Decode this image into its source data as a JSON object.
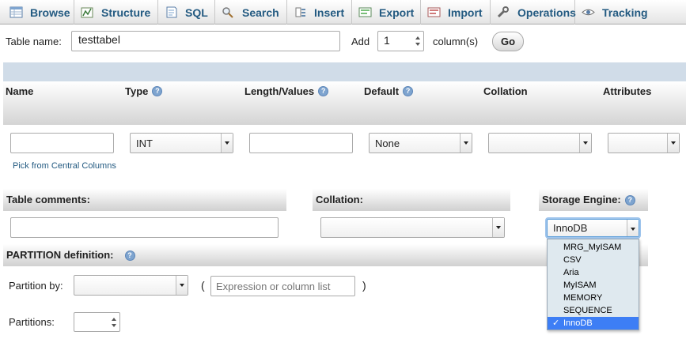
{
  "tabs": [
    {
      "label": "Browse",
      "icon": "browse-icon"
    },
    {
      "label": "Structure",
      "icon": "structure-icon"
    },
    {
      "label": "SQL",
      "icon": "sql-icon"
    },
    {
      "label": "Search",
      "icon": "search-icon"
    },
    {
      "label": "Insert",
      "icon": "insert-icon"
    },
    {
      "label": "Export",
      "icon": "export-icon"
    },
    {
      "label": "Import",
      "icon": "import-icon"
    },
    {
      "label": "Operations",
      "icon": "wrench-icon"
    },
    {
      "label": "Tracking",
      "icon": "eye-icon"
    }
  ],
  "table_form": {
    "table_name_label": "Table name:",
    "table_name_value": "testtabel",
    "add_label": "Add",
    "add_count": "1",
    "columns_label": "column(s)",
    "go_label": "Go"
  },
  "columns": {
    "headers": {
      "name": "Name",
      "type": "Type",
      "length": "Length/Values",
      "default": "Default",
      "collation": "Collation",
      "attributes": "Attributes"
    },
    "row": {
      "type_value": "INT",
      "default_value": "None",
      "pick_link": "Pick from Central Columns"
    }
  },
  "table_options": {
    "comments_label": "Table comments:",
    "collation_label": "Collation:",
    "engine_label": "Storage Engine:",
    "engine_value": "InnoDB",
    "engine_options": [
      "MRG_MyISAM",
      "CSV",
      "Aria",
      "MyISAM",
      "MEMORY",
      "SEQUENCE",
      "InnoDB"
    ],
    "engine_selected_index": 6,
    "check_mark": "✓"
  },
  "partition": {
    "title": "PARTITION definition:",
    "partition_by_label": "Partition by:",
    "open_paren": "(",
    "close_paren": ")",
    "expression_placeholder": "Expression or column list",
    "partitions_label": "Partitions:"
  },
  "colors": {
    "tab_text": "#235a81",
    "selected_option": "#3d7ef5",
    "dropdown_bg": "#dfe9ef",
    "help_icon": "#7ea4cf"
  }
}
